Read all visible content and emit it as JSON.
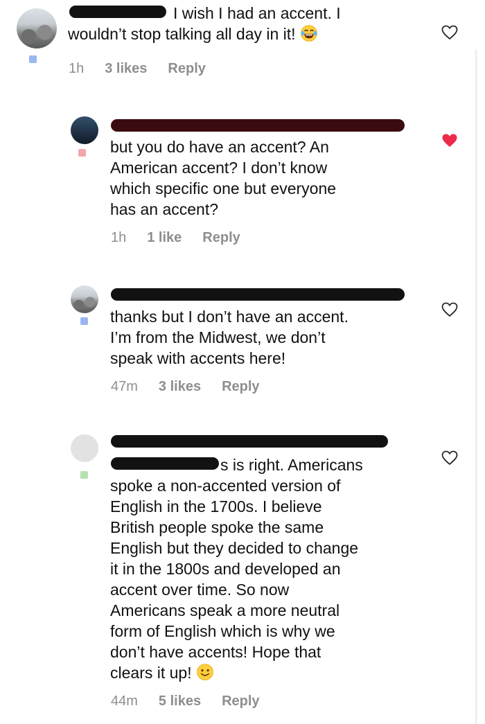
{
  "comments": [
    {
      "text": "I wish I had an accent. I\nwouldn’t stop talking all day in it!",
      "emoji": "laughing-tears",
      "time": "1h",
      "likes": "3 likes",
      "reply": "Reply",
      "liked": false,
      "badge_color": "#9bb7ef"
    },
    {
      "text": "but you do have an accent? An\nAmerican accent? I don’t know\nwhich specific one but everyone\nhas an accent?",
      "time": "1h",
      "likes": "1 like",
      "reply": "Reply",
      "liked": true,
      "badge_color": "#f2a7a7"
    },
    {
      "text": "thanks but I don’t have an accent.\nI’m from the Midwest, we don’t\nspeak with accents here!",
      "time": "47m",
      "likes": "3 likes",
      "reply": "Reply",
      "liked": false,
      "badge_color": "#9db4f2"
    },
    {
      "first_line_suffix": "s is right. Americans",
      "text": "spoke a non-accented version of\nEnglish in the 1700s. I believe\nBritish people spoke the same\nEnglish but they decided to change\nit in the 1800s and developed an\naccent over time. So now\nAmericans speak a more neutral\nform of English which is why we\ndon’t have accents! Hope that\nclears it up!",
      "emoji": "slight-smile",
      "time": "44m",
      "likes": "5 likes",
      "reply": "Reply",
      "liked": false,
      "badge_color": "#b9e0b0"
    }
  ],
  "colors": {
    "heart_liked": "#ee2a4b",
    "heart_outline": "#262626",
    "meta_text": "#8e8e8e"
  },
  "icons": [
    "heart-outline-icon",
    "heart-filled-icon",
    "laughing-tears-emoji",
    "slight-smile-emoji"
  ]
}
